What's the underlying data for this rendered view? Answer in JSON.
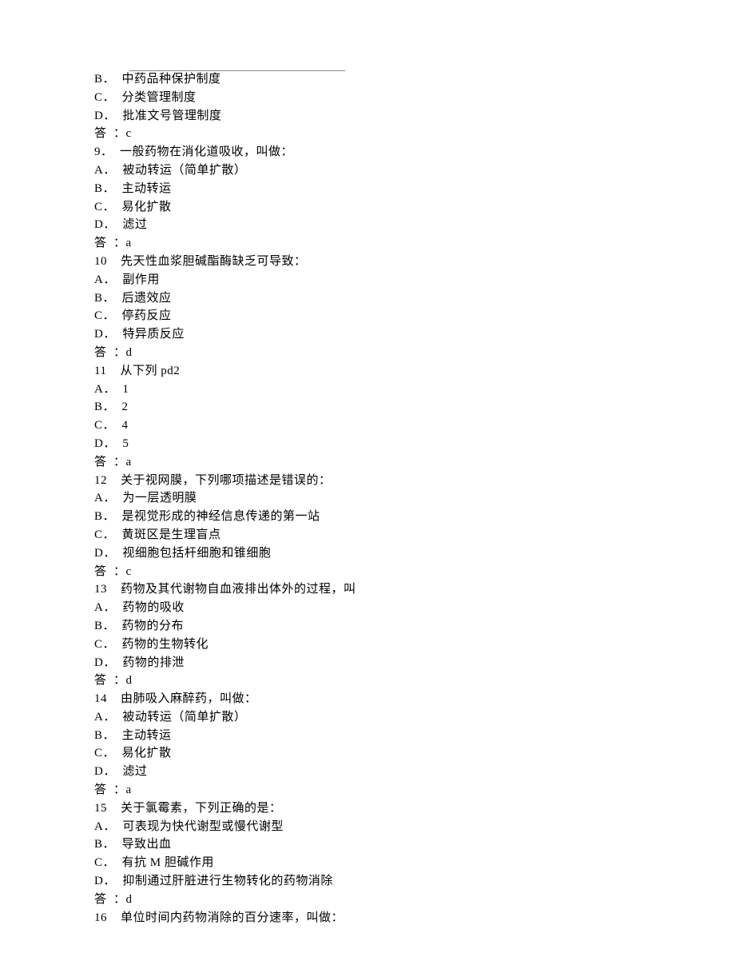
{
  "lines": [
    {
      "prefix": "B．",
      "text": "中药品种保护制度"
    },
    {
      "prefix": "C．",
      "text": "分类管理制度"
    },
    {
      "prefix": "D．",
      "text": "批准文号管理制度"
    },
    {
      "prefix": "答",
      "text": "：c"
    },
    {
      "prefix": "9．",
      "text": "一般药物在消化道吸收，叫做："
    },
    {
      "prefix": "A．",
      "text": "被动转运（简单扩散）"
    },
    {
      "prefix": "B．",
      "text": "主动转运"
    },
    {
      "prefix": "C．",
      "text": "易化扩散"
    },
    {
      "prefix": "D．",
      "text": "滤过"
    },
    {
      "prefix": "答",
      "text": "：a"
    },
    {
      "prefix": "10",
      "text": "先天性血浆胆碱酯酶缺乏可导致：",
      "indent": true
    },
    {
      "prefix": "A．",
      "text": "副作用"
    },
    {
      "prefix": "B．",
      "text": "后遗效应"
    },
    {
      "prefix": "C．",
      "text": "停药反应"
    },
    {
      "prefix": "D．",
      "text": "特异质反应"
    },
    {
      "prefix": "答",
      "text": "：d"
    },
    {
      "prefix": "11",
      "text": "从下列 pd2",
      "indent": true
    },
    {
      "prefix": "A．",
      "text": "1"
    },
    {
      "prefix": "B．",
      "text": "2"
    },
    {
      "prefix": "C．",
      "text": "4"
    },
    {
      "prefix": "D．",
      "text": "5"
    },
    {
      "prefix": "答",
      "text": "：a"
    },
    {
      "prefix": "12",
      "text": "关于视网膜，下列哪项描述是错误的：",
      "indent": true
    },
    {
      "prefix": "A．",
      "text": "为一层透明膜"
    },
    {
      "prefix": "B．",
      "text": "是视觉形成的神经信息传递的第一站"
    },
    {
      "prefix": "C．",
      "text": "黄斑区是生理盲点"
    },
    {
      "prefix": "D．",
      "text": "视细胞包括杆细胞和锥细胞"
    },
    {
      "prefix": "答",
      "text": "：c"
    },
    {
      "prefix": "13",
      "text": "药物及其代谢物自血液排出体外的过程，叫",
      "indent": true
    },
    {
      "prefix": "A．",
      "text": "药物的吸收"
    },
    {
      "prefix": "B．",
      "text": "药物的分布"
    },
    {
      "prefix": "C．",
      "text": "药物的生物转化"
    },
    {
      "prefix": "D．",
      "text": "药物的排泄"
    },
    {
      "prefix": "答",
      "text": "：d"
    },
    {
      "prefix": "14",
      "text": "由肺吸入麻醉药，叫做：",
      "indent": true
    },
    {
      "prefix": "A．",
      "text": "被动转运（简单扩散）"
    },
    {
      "prefix": "B．",
      "text": "主动转运"
    },
    {
      "prefix": "C．",
      "text": "易化扩散"
    },
    {
      "prefix": "D．",
      "text": "滤过"
    },
    {
      "prefix": "答",
      "text": "：a"
    },
    {
      "prefix": "15",
      "text": "关于氯霉素，下列正确的是：",
      "indent": true
    },
    {
      "prefix": "A．",
      "text": "可表现为快代谢型或慢代谢型"
    },
    {
      "prefix": "B．",
      "text": "导致出血"
    },
    {
      "prefix": "C．",
      "text": "有抗 M 胆碱作用"
    },
    {
      "prefix": "D．",
      "text": "抑制通过肝脏进行生物转化的药物消除"
    },
    {
      "prefix": "答",
      "text": "：d"
    },
    {
      "prefix": "16",
      "text": "单位时间内药物消除的百分速率，叫做：",
      "indent": true
    }
  ]
}
